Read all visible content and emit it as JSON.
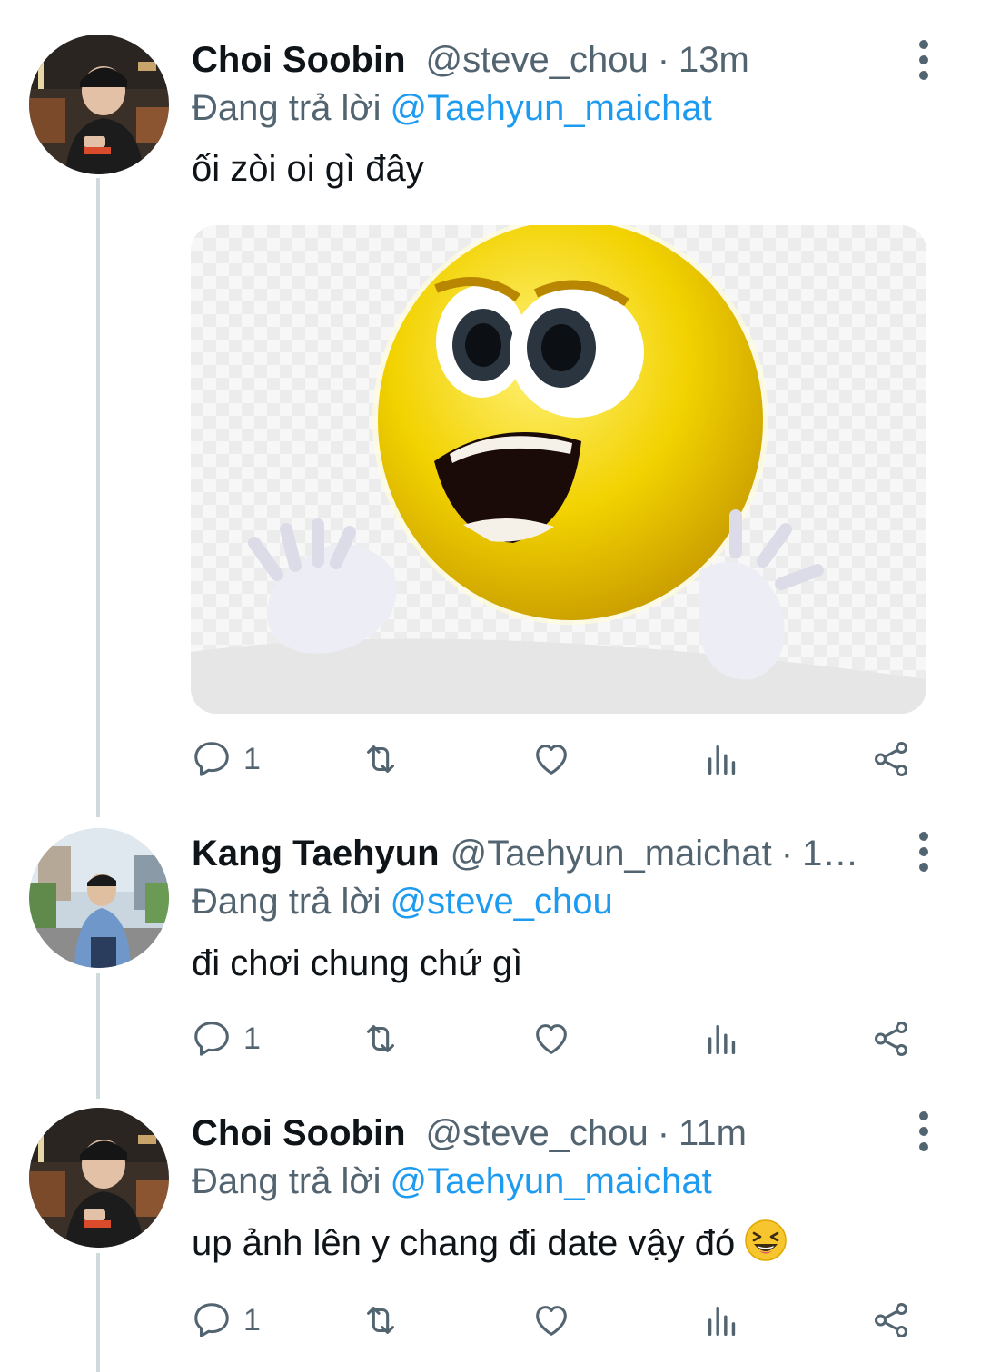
{
  "tweets": [
    {
      "author_name": "Choi Soobin",
      "handle": "@steve_chou",
      "separator": "·",
      "time": "13m",
      "reply_prefix": "Đang trả lời",
      "reply_to": "@Taehyun_maichat",
      "text": "ối zòi oi gì đây",
      "has_media": true,
      "media": "yellow-emoji-shouting-image",
      "reply_count": "1",
      "avatar": "photo-person-in-cap"
    },
    {
      "author_name": "Kang Taehyun",
      "handle": "@Taehyun_maichat",
      "separator": "·",
      "time": "1…",
      "reply_prefix": "Đang trả lời",
      "reply_to": "@steve_chou",
      "text": "đi chơi chung chứ gì",
      "has_media": false,
      "reply_count": "1",
      "avatar": "photo-person-on-street"
    },
    {
      "author_name": "Choi Soobin",
      "handle": "@steve_chou",
      "separator": "·",
      "time": "11m",
      "reply_prefix": "Đang trả lời",
      "reply_to": "@Taehyun_maichat",
      "text": "up ảnh lên y chang đi date vậy đó",
      "emoji": "laughing-squint-emoji",
      "has_media": false,
      "reply_count": "1",
      "avatar": "photo-person-in-cap"
    }
  ],
  "icons": {
    "reply": "reply-icon",
    "retweet": "retweet-icon",
    "like": "heart-icon",
    "views": "analytics-icon",
    "share": "share-icon",
    "more": "more-vertical-icon"
  },
  "colors": {
    "link": "#1d9bf0",
    "secondary_text": "#536471",
    "thread_line": "#cfd9de",
    "emoji_yellow": "#f2d200"
  }
}
